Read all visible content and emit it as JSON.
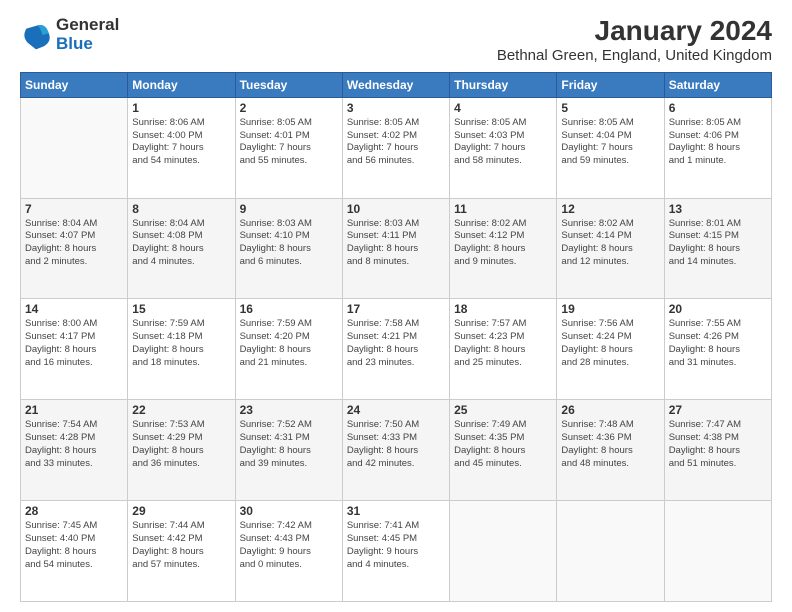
{
  "header": {
    "logo_general": "General",
    "logo_blue": "Blue",
    "title": "January 2024",
    "subtitle": "Bethnal Green, England, United Kingdom"
  },
  "calendar": {
    "headers": [
      "Sunday",
      "Monday",
      "Tuesday",
      "Wednesday",
      "Thursday",
      "Friday",
      "Saturday"
    ],
    "rows": [
      [
        {
          "day": "",
          "info": ""
        },
        {
          "day": "1",
          "info": "Sunrise: 8:06 AM\nSunset: 4:00 PM\nDaylight: 7 hours\nand 54 minutes."
        },
        {
          "day": "2",
          "info": "Sunrise: 8:05 AM\nSunset: 4:01 PM\nDaylight: 7 hours\nand 55 minutes."
        },
        {
          "day": "3",
          "info": "Sunrise: 8:05 AM\nSunset: 4:02 PM\nDaylight: 7 hours\nand 56 minutes."
        },
        {
          "day": "4",
          "info": "Sunrise: 8:05 AM\nSunset: 4:03 PM\nDaylight: 7 hours\nand 58 minutes."
        },
        {
          "day": "5",
          "info": "Sunrise: 8:05 AM\nSunset: 4:04 PM\nDaylight: 7 hours\nand 59 minutes."
        },
        {
          "day": "6",
          "info": "Sunrise: 8:05 AM\nSunset: 4:06 PM\nDaylight: 8 hours\nand 1 minute."
        }
      ],
      [
        {
          "day": "7",
          "info": "Sunrise: 8:04 AM\nSunset: 4:07 PM\nDaylight: 8 hours\nand 2 minutes."
        },
        {
          "day": "8",
          "info": "Sunrise: 8:04 AM\nSunset: 4:08 PM\nDaylight: 8 hours\nand 4 minutes."
        },
        {
          "day": "9",
          "info": "Sunrise: 8:03 AM\nSunset: 4:10 PM\nDaylight: 8 hours\nand 6 minutes."
        },
        {
          "day": "10",
          "info": "Sunrise: 8:03 AM\nSunset: 4:11 PM\nDaylight: 8 hours\nand 8 minutes."
        },
        {
          "day": "11",
          "info": "Sunrise: 8:02 AM\nSunset: 4:12 PM\nDaylight: 8 hours\nand 9 minutes."
        },
        {
          "day": "12",
          "info": "Sunrise: 8:02 AM\nSunset: 4:14 PM\nDaylight: 8 hours\nand 12 minutes."
        },
        {
          "day": "13",
          "info": "Sunrise: 8:01 AM\nSunset: 4:15 PM\nDaylight: 8 hours\nand 14 minutes."
        }
      ],
      [
        {
          "day": "14",
          "info": "Sunrise: 8:00 AM\nSunset: 4:17 PM\nDaylight: 8 hours\nand 16 minutes."
        },
        {
          "day": "15",
          "info": "Sunrise: 7:59 AM\nSunset: 4:18 PM\nDaylight: 8 hours\nand 18 minutes."
        },
        {
          "day": "16",
          "info": "Sunrise: 7:59 AM\nSunset: 4:20 PM\nDaylight: 8 hours\nand 21 minutes."
        },
        {
          "day": "17",
          "info": "Sunrise: 7:58 AM\nSunset: 4:21 PM\nDaylight: 8 hours\nand 23 minutes."
        },
        {
          "day": "18",
          "info": "Sunrise: 7:57 AM\nSunset: 4:23 PM\nDaylight: 8 hours\nand 25 minutes."
        },
        {
          "day": "19",
          "info": "Sunrise: 7:56 AM\nSunset: 4:24 PM\nDaylight: 8 hours\nand 28 minutes."
        },
        {
          "day": "20",
          "info": "Sunrise: 7:55 AM\nSunset: 4:26 PM\nDaylight: 8 hours\nand 31 minutes."
        }
      ],
      [
        {
          "day": "21",
          "info": "Sunrise: 7:54 AM\nSunset: 4:28 PM\nDaylight: 8 hours\nand 33 minutes."
        },
        {
          "day": "22",
          "info": "Sunrise: 7:53 AM\nSunset: 4:29 PM\nDaylight: 8 hours\nand 36 minutes."
        },
        {
          "day": "23",
          "info": "Sunrise: 7:52 AM\nSunset: 4:31 PM\nDaylight: 8 hours\nand 39 minutes."
        },
        {
          "day": "24",
          "info": "Sunrise: 7:50 AM\nSunset: 4:33 PM\nDaylight: 8 hours\nand 42 minutes."
        },
        {
          "day": "25",
          "info": "Sunrise: 7:49 AM\nSunset: 4:35 PM\nDaylight: 8 hours\nand 45 minutes."
        },
        {
          "day": "26",
          "info": "Sunrise: 7:48 AM\nSunset: 4:36 PM\nDaylight: 8 hours\nand 48 minutes."
        },
        {
          "day": "27",
          "info": "Sunrise: 7:47 AM\nSunset: 4:38 PM\nDaylight: 8 hours\nand 51 minutes."
        }
      ],
      [
        {
          "day": "28",
          "info": "Sunrise: 7:45 AM\nSunset: 4:40 PM\nDaylight: 8 hours\nand 54 minutes."
        },
        {
          "day": "29",
          "info": "Sunrise: 7:44 AM\nSunset: 4:42 PM\nDaylight: 8 hours\nand 57 minutes."
        },
        {
          "day": "30",
          "info": "Sunrise: 7:42 AM\nSunset: 4:43 PM\nDaylight: 9 hours\nand 0 minutes."
        },
        {
          "day": "31",
          "info": "Sunrise: 7:41 AM\nSunset: 4:45 PM\nDaylight: 9 hours\nand 4 minutes."
        },
        {
          "day": "",
          "info": ""
        },
        {
          "day": "",
          "info": ""
        },
        {
          "day": "",
          "info": ""
        }
      ]
    ]
  }
}
